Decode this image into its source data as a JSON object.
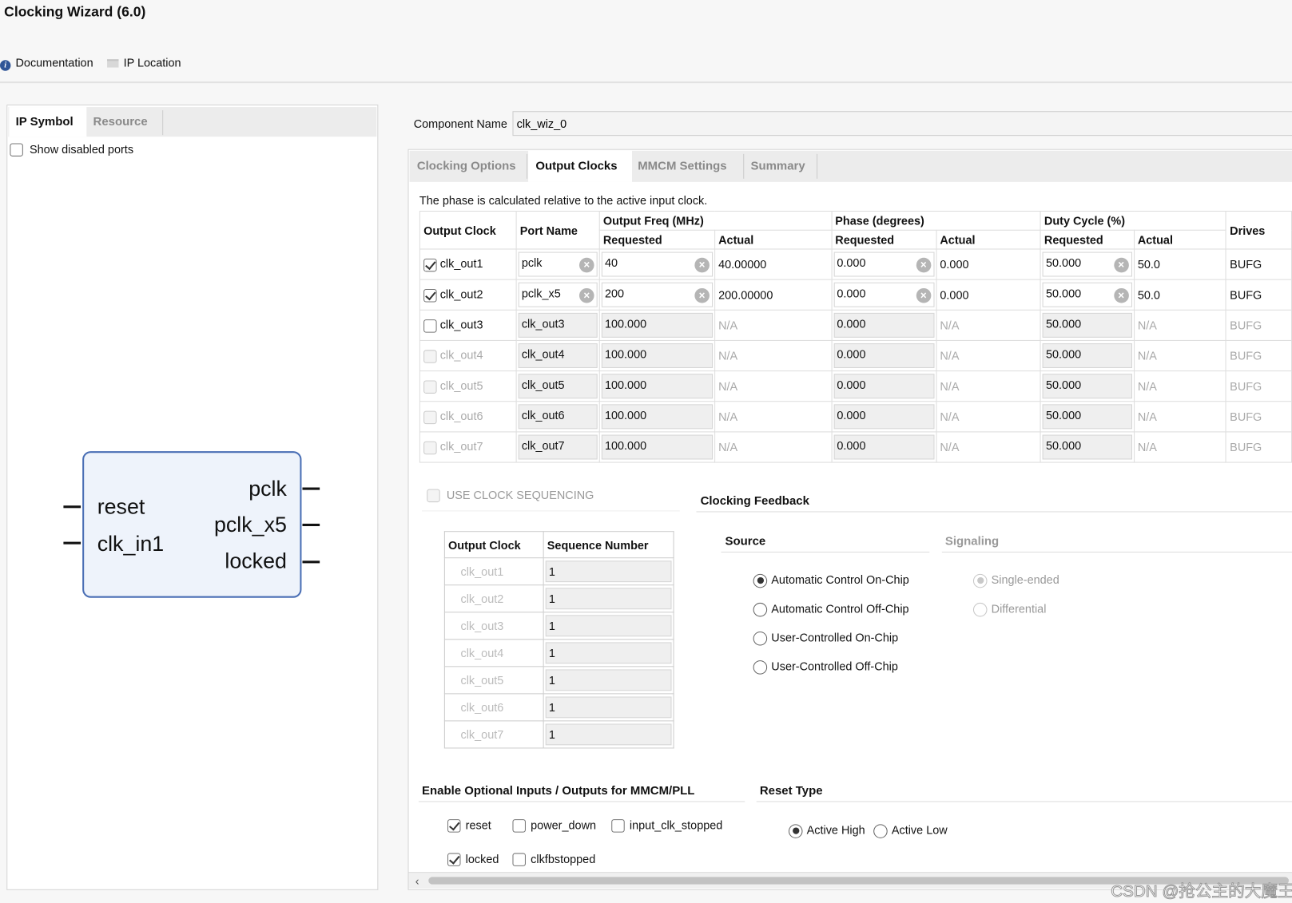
{
  "window": {
    "title": "Clocking Wizard (6.0)"
  },
  "toolbar": {
    "documentation": "Documentation",
    "ip_location": "IP Location"
  },
  "left": {
    "tabs": [
      "IP Symbol",
      "Resource"
    ],
    "show_disabled_ports": "Show disabled ports",
    "show_disabled_checked": false,
    "symbol": {
      "inputs": [
        "reset",
        "clk_in1"
      ],
      "outputs": [
        "pclk",
        "pclk_x5",
        "locked"
      ]
    }
  },
  "component": {
    "label": "Component Name",
    "value": "clk_wiz_0"
  },
  "tabs": [
    "Clocking Options",
    "Output Clocks",
    "MMCM Settings",
    "Summary"
  ],
  "active_tab": "Output Clocks",
  "note": "The phase is calculated relative to the active input clock.",
  "table": {
    "headers": {
      "output_clock": "Output Clock",
      "port_name": "Port Name",
      "freq": "Output Freq (MHz)",
      "phase": "Phase (degrees)",
      "duty": "Duty Cycle (%)",
      "drives": "Drives",
      "requested": "Requested",
      "actual": "Actual"
    },
    "rows": [
      {
        "enabled": true,
        "checked": true,
        "clock": "clk_out1",
        "port": "pclk",
        "freq": "40",
        "freq_actual": "40.00000",
        "phase": "0.000",
        "phase_actual": "0.000",
        "duty": "50.000",
        "duty_actual": "50.0",
        "drives": "BUFG"
      },
      {
        "enabled": true,
        "checked": true,
        "clock": "clk_out2",
        "port": "pclk_x5",
        "freq": "200",
        "freq_actual": "200.00000",
        "phase": "0.000",
        "phase_actual": "0.000",
        "duty": "50.000",
        "duty_actual": "50.0",
        "drives": "BUFG"
      },
      {
        "enabled": true,
        "checked": false,
        "clock": "clk_out3",
        "port": "clk_out3",
        "freq": "100.000",
        "freq_actual": "N/A",
        "phase": "0.000",
        "phase_actual": "N/A",
        "duty": "50.000",
        "duty_actual": "N/A",
        "drives": "BUFG"
      },
      {
        "enabled": false,
        "checked": false,
        "clock": "clk_out4",
        "port": "clk_out4",
        "freq": "100.000",
        "freq_actual": "N/A",
        "phase": "0.000",
        "phase_actual": "N/A",
        "duty": "50.000",
        "duty_actual": "N/A",
        "drives": "BUFG"
      },
      {
        "enabled": false,
        "checked": false,
        "clock": "clk_out5",
        "port": "clk_out5",
        "freq": "100.000",
        "freq_actual": "N/A",
        "phase": "0.000",
        "phase_actual": "N/A",
        "duty": "50.000",
        "duty_actual": "N/A",
        "drives": "BUFG"
      },
      {
        "enabled": false,
        "checked": false,
        "clock": "clk_out6",
        "port": "clk_out6",
        "freq": "100.000",
        "freq_actual": "N/A",
        "phase": "0.000",
        "phase_actual": "N/A",
        "duty": "50.000",
        "duty_actual": "N/A",
        "drives": "BUFG"
      },
      {
        "enabled": false,
        "checked": false,
        "clock": "clk_out7",
        "port": "clk_out7",
        "freq": "100.000",
        "freq_actual": "N/A",
        "phase": "0.000",
        "phase_actual": "N/A",
        "duty": "50.000",
        "duty_actual": "N/A",
        "drives": "BUFG"
      }
    ]
  },
  "sequencing": {
    "label": "USE CLOCK SEQUENCING",
    "checked": false,
    "headers": [
      "Output Clock",
      "Sequence Number"
    ],
    "rows": [
      [
        "clk_out1",
        "1"
      ],
      [
        "clk_out2",
        "1"
      ],
      [
        "clk_out3",
        "1"
      ],
      [
        "clk_out4",
        "1"
      ],
      [
        "clk_out5",
        "1"
      ],
      [
        "clk_out6",
        "1"
      ],
      [
        "clk_out7",
        "1"
      ]
    ]
  },
  "feedback": {
    "title": "Clocking Feedback",
    "source_label": "Source",
    "signaling_label": "Signaling",
    "source_options": [
      "Automatic Control On-Chip",
      "Automatic Control Off-Chip",
      "User-Controlled On-Chip",
      "User-Controlled Off-Chip"
    ],
    "source_selected": "Automatic Control On-Chip",
    "signaling_options": [
      "Single-ended",
      "Differential"
    ],
    "signaling_selected": "Single-ended"
  },
  "optional": {
    "title": "Enable Optional Inputs / Outputs for MMCM/PLL",
    "items": [
      {
        "label": "reset",
        "checked": true
      },
      {
        "label": "power_down",
        "checked": false
      },
      {
        "label": "input_clk_stopped",
        "checked": false
      },
      {
        "label": "locked",
        "checked": true
      },
      {
        "label": "clkfbstopped",
        "checked": false
      }
    ]
  },
  "reset_type": {
    "title": "Reset Type",
    "options": [
      "Active High",
      "Active Low"
    ],
    "selected": "Active High"
  },
  "watermark": "CSDN @抢公主的大魔王",
  "colors": {
    "symbol_border": "#4a6fb5",
    "symbol_fill": "#eef3fb",
    "info_icon": "#2f5597"
  }
}
